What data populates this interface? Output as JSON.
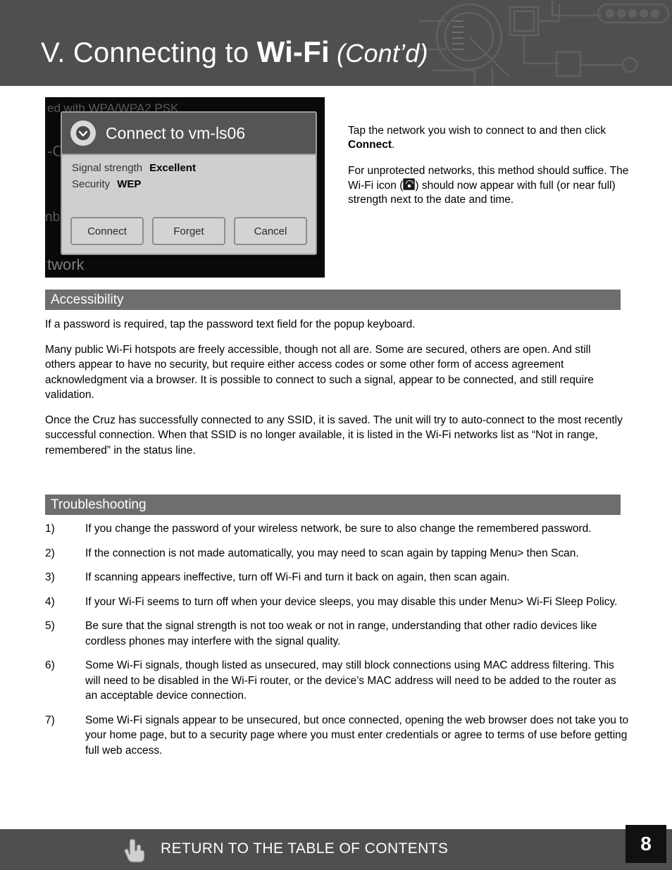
{
  "header": {
    "title_part1": "V. Connecting to ",
    "title_part2": "Wi-Fi",
    "title_part3": " (Cont’d)"
  },
  "figure": {
    "ghost_top": "ed with WPA/WPA2 PSK",
    "ghost_mid": "-C",
    "ghost_left": "nb",
    "ghost_bottom": "twork",
    "dialog": {
      "title": "Connect to vm-ls06",
      "badge_icon": "chevron-down-circle-icon",
      "rows": [
        {
          "label": "Signal strength",
          "value": "Excellent"
        },
        {
          "label": "Security",
          "value": "WEP"
        }
      ],
      "buttons": [
        "Connect",
        "Forget",
        "Cancel"
      ]
    }
  },
  "side_text": {
    "p1_a": "Tap the network you wish to connect to and then click ",
    "p1_b": "Connect",
    "p1_c": ".",
    "p2_a": "For unprotected networks, this method should suffice.  The Wi-Fi icon (",
    "p2_b": ") should now appear with full (or near full) strength next to the date and time."
  },
  "sections": {
    "accessibility": {
      "heading": "Accessibility",
      "paragraphs": [
        "If a password is required, tap the password text field for the popup keyboard.",
        "Many public Wi-Fi hotspots are freely accessible, though not all are. Some are secured, others are open. And still others appear to have no security, but require either access codes or some other form of access agreement acknowledgment via a browser. It is possible to connect to such a signal, appear to be connected, and still require validation.",
        "Once the Cruz has successfully connected to any SSID, it is saved.  The unit will try to auto-connect to the most recently successful connection.  When that SSID is no longer available, it is listed in the Wi-Fi networks list as “Not in range, remembered” in the status line."
      ]
    },
    "troubleshooting": {
      "heading": "Troubleshooting",
      "items": [
        {
          "num": "1)",
          "text": "If you change the password of your wireless network, be sure to also change the remembered password."
        },
        {
          "num": "2)",
          "text": "If the connection is not made automatically, you may need to scan again by tapping Menu> then Scan."
        },
        {
          "num": "3)",
          "text": "If scanning appears ineffective, turn off Wi-Fi and turn it back on again, then scan again."
        },
        {
          "num": "4)",
          "text": "If your Wi-Fi seems to turn off when your device sleeps, you may disable this under Menu> Wi-Fi Sleep Policy."
        },
        {
          "num": "5)",
          "text": "Be sure that the signal strength is not too weak or not in range, understanding that other radio devices like cordless phones may interfere with the signal quality."
        },
        {
          "num": "6)",
          "text": "Some Wi-Fi signals, though listed as unsecured, may still block connections using MAC address filtering. This will need to be disabled in the Wi-Fi router, or the device’s MAC address will need to be added to the router as an acceptable device connection."
        },
        {
          "num": "7)",
          "text": "Some Wi-Fi signals appear to be unsecured, but once connected, opening the web browser does not take you to your home page, but to a security page where you must enter credentials or agree to terms of use before getting full web access."
        }
      ]
    }
  },
  "footer": {
    "link_label": "RETURN TO THE TABLE OF CONTENTS",
    "page_number": "8",
    "hand_icon": "pointing-hand-icon"
  }
}
